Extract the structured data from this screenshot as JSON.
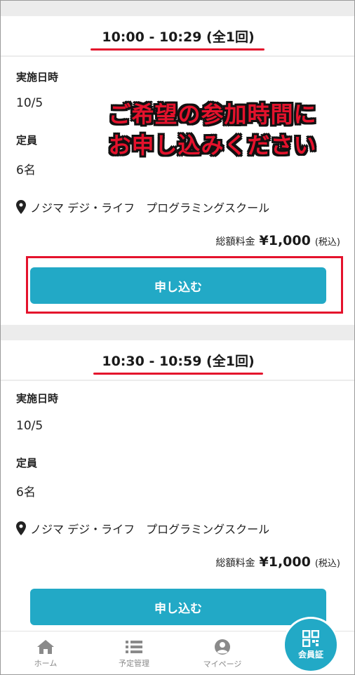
{
  "overlay": {
    "line1": "ご希望の参加時間に",
    "line2": "お申し込みください"
  },
  "slots": [
    {
      "title": "10:00 - 10:29 (全1回)",
      "date_label": "実施日時",
      "date_value": "10/5",
      "capacity_label": "定員",
      "capacity_value": "6名",
      "location": "ノジマ デジ・ライフ　プログラミングスクール",
      "price_label": "総額料金",
      "price_amount": "¥1,000",
      "price_tax": "(税込)",
      "apply_label": "申し込む"
    },
    {
      "title": "10:30 - 10:59 (全1回)",
      "date_label": "実施日時",
      "date_value": "10/5",
      "capacity_label": "定員",
      "capacity_value": "6名",
      "location": "ノジマ デジ・ライフ　プログラミングスクール",
      "price_label": "総額料金",
      "price_amount": "¥1,000",
      "price_tax": "(税込)",
      "apply_label": "申し込む"
    }
  ],
  "tabbar": {
    "home": {
      "label": "ホーム",
      "icon": "home-icon"
    },
    "schedule": {
      "label": "予定管理",
      "icon": "list-icon"
    },
    "mypage": {
      "label": "マイページ",
      "icon": "user-icon"
    },
    "member": {
      "label": "会員証",
      "icon": "qr-code-icon"
    }
  },
  "colors": {
    "accent": "#22a9c6",
    "highlight_red": "#e4122c",
    "band_gray": "#ececec"
  }
}
